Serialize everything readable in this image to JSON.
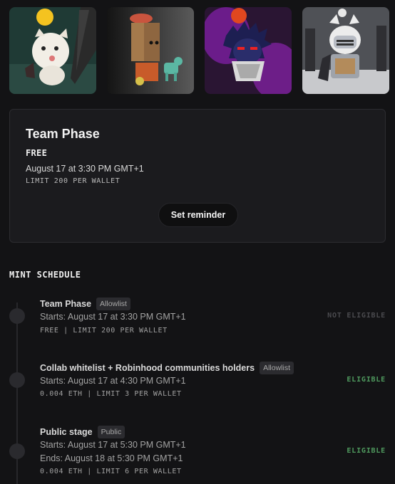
{
  "gallery": {
    "items": [
      {
        "alt": "Moogle-like creature with sword NFT"
      },
      {
        "alt": "Box-head character with dog NFT"
      },
      {
        "alt": "Spiky dark ninja NFT"
      },
      {
        "alt": "Armored knight cat NFT"
      }
    ]
  },
  "active_stage": {
    "title": "Team Phase",
    "price": "FREE",
    "date": "August 17 at 3:30 PM GMT+1",
    "limit": "LIMIT 200 PER WALLET",
    "reminder_label": "Set reminder"
  },
  "schedule": {
    "heading": "MINT SCHEDULE",
    "stages": [
      {
        "name": "Team Phase",
        "badge": "Allowlist",
        "starts": "Starts: August 17 at 3:30 PM GMT+1",
        "meta": "FREE | LIMIT 200 PER WALLET",
        "eligibility": "NOT ELIGIBLE",
        "eligibility_color": "#4a4a4e"
      },
      {
        "name": "Collab whitelist + Robinhood communities holders",
        "badge": "Allowlist",
        "starts": "Starts: August 17 at 4:30 PM GMT+1",
        "meta": "0.004 ETH | LIMIT 3 PER WALLET",
        "eligibility": "ELIGIBLE",
        "eligibility_color": "#4f9a5e"
      },
      {
        "name": "Public stage",
        "badge": "Public",
        "starts": "Starts: August 17 at 5:30 PM GMT+1",
        "ends": "Ends: August 18 at 5:30 PM GMT+1",
        "meta": "0.004 ETH | LIMIT 6 PER WALLET",
        "eligibility": "ELIGIBLE",
        "eligibility_color": "#4f9a5e"
      }
    ]
  }
}
